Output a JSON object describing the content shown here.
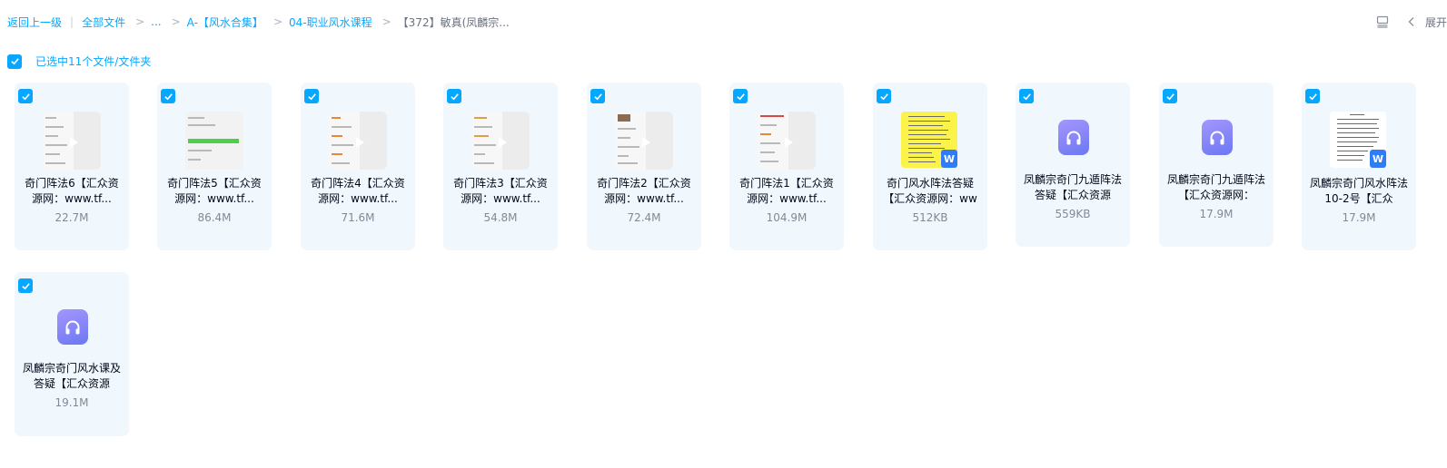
{
  "breadcrumb": {
    "back": "返回上一级",
    "all_files": "全部文件",
    "ellipsis": "...",
    "folder1": "A-【风水合集】",
    "folder2": "04-职业风水课程",
    "current": "【372】敏真(凤麟宗...",
    "separator": ">"
  },
  "toolbar": {
    "expand_label": "展开"
  },
  "selection": {
    "label": "已选中11个文件/文件夹",
    "checked": true
  },
  "files": [
    {
      "type": "video",
      "name": "奇门阵法6【汇众资源网：www.tf...",
      "size": "22.7M",
      "checked": true
    },
    {
      "type": "video",
      "name": "奇门阵法5【汇众资源网：www.tf...",
      "size": "86.4M",
      "checked": true
    },
    {
      "type": "video",
      "name": "奇门阵法4【汇众资源网：www.tf...",
      "size": "71.6M",
      "checked": true
    },
    {
      "type": "video",
      "name": "奇门阵法3【汇众资源网：www.tf...",
      "size": "54.8M",
      "checked": true
    },
    {
      "type": "video",
      "name": "奇门阵法2【汇众资源网：www.tf...",
      "size": "72.4M",
      "checked": true
    },
    {
      "type": "video",
      "name": "奇门阵法1【汇众资源网：www.tf...",
      "size": "104.9M",
      "checked": true
    },
    {
      "type": "doc",
      "name": "奇门风水阵法答疑【汇众资源网：ww",
      "size": "512KB",
      "checked": true
    },
    {
      "type": "audio",
      "name": "凤麟宗奇门九遁阵法答疑【汇众资源",
      "size": "559KB",
      "checked": true
    },
    {
      "type": "audio",
      "name": "凤麟宗奇门九遁阵法【汇众资源网：",
      "size": "17.9M",
      "checked": true
    },
    {
      "type": "doc",
      "name": "凤麟宗奇门风水阵法10-2号【汇众",
      "size": "17.9M",
      "checked": true
    },
    {
      "type": "audio",
      "name": "凤麟宗奇门风水课及答疑【汇众资源",
      "size": "19.1M",
      "checked": true
    }
  ],
  "icons": {
    "checkbox": "checkbox-checked-icon",
    "list_view": "list-view-icon",
    "chevron": "chevron-left-icon",
    "audio": "headphones-icon",
    "doc_badge": "word-doc-icon",
    "doc_badge_letter": "W"
  },
  "colors": {
    "accent": "#06a7ff",
    "card_bg": "#f1f8fd",
    "audio_icon": "#7c83f5",
    "word_badge": "#2f7cf6"
  }
}
